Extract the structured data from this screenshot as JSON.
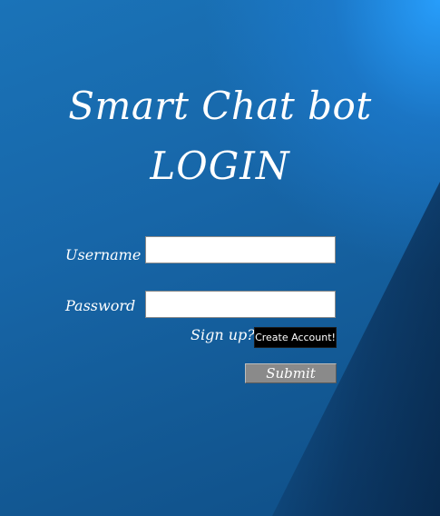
{
  "header": {
    "title_line1": "Smart Chat bot",
    "title_line2": "LOGIN"
  },
  "form": {
    "username_label": "Username",
    "username_value": "",
    "password_label": "Password",
    "password_value": "",
    "signup_prompt": "Sign up?",
    "create_account_label": "Create Account!",
    "submit_label": "Submit"
  },
  "colors": {
    "background_primary": "#1766a8",
    "background_highlight": "#2aa0ff",
    "text": "#ffffff",
    "create_account_bg": "#000000",
    "submit_bg": "#8a8a8a"
  }
}
